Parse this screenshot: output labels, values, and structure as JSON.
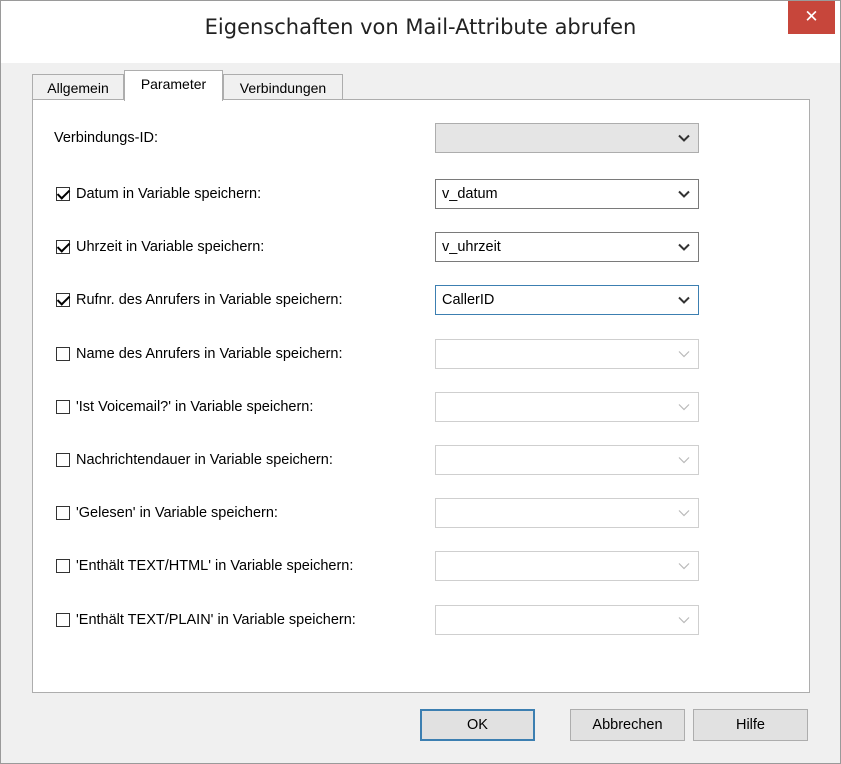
{
  "window": {
    "title": "Eigenschaften von Mail-Attribute abrufen",
    "close_glyph": "✕"
  },
  "tabs": [
    {
      "label": "Allgemein",
      "active": false
    },
    {
      "label": "Parameter",
      "active": true
    },
    {
      "label": "Verbindungen",
      "active": false
    }
  ],
  "connection": {
    "label": "Verbindungs-ID:",
    "value": ""
  },
  "rows": [
    {
      "label": "Datum in Variable speichern:",
      "checked": true,
      "value": "v_datum",
      "enabled": true
    },
    {
      "label": "Uhrzeit in Variable speichern:",
      "checked": true,
      "value": "v_uhrzeit",
      "enabled": true
    },
    {
      "label": "Rufnr. des Anrufers in Variable speichern:",
      "checked": true,
      "value": "CallerID",
      "enabled": true
    },
    {
      "label": "Name des Anrufers in Variable speichern:",
      "checked": false,
      "value": "",
      "enabled": false
    },
    {
      "label": "'Ist Voicemail?' in Variable speichern:",
      "checked": false,
      "value": "",
      "enabled": false
    },
    {
      "label": "Nachrichtendauer in Variable speichern:",
      "checked": false,
      "value": "",
      "enabled": false
    },
    {
      "label": "'Gelesen' in Variable speichern:",
      "checked": false,
      "value": "",
      "enabled": false
    },
    {
      "label": "'Enthält TEXT/HTML' in Variable speichern:",
      "checked": false,
      "value": "",
      "enabled": false
    },
    {
      "label": "'Enthält TEXT/PLAIN' in Variable speichern:",
      "checked": false,
      "value": "",
      "enabled": false
    }
  ],
  "buttons": {
    "ok": "OK",
    "cancel": "Abbrechen",
    "help": "Hilfe"
  },
  "colors": {
    "close_button": "#c7463b",
    "focus_border": "#3c7fb1"
  }
}
